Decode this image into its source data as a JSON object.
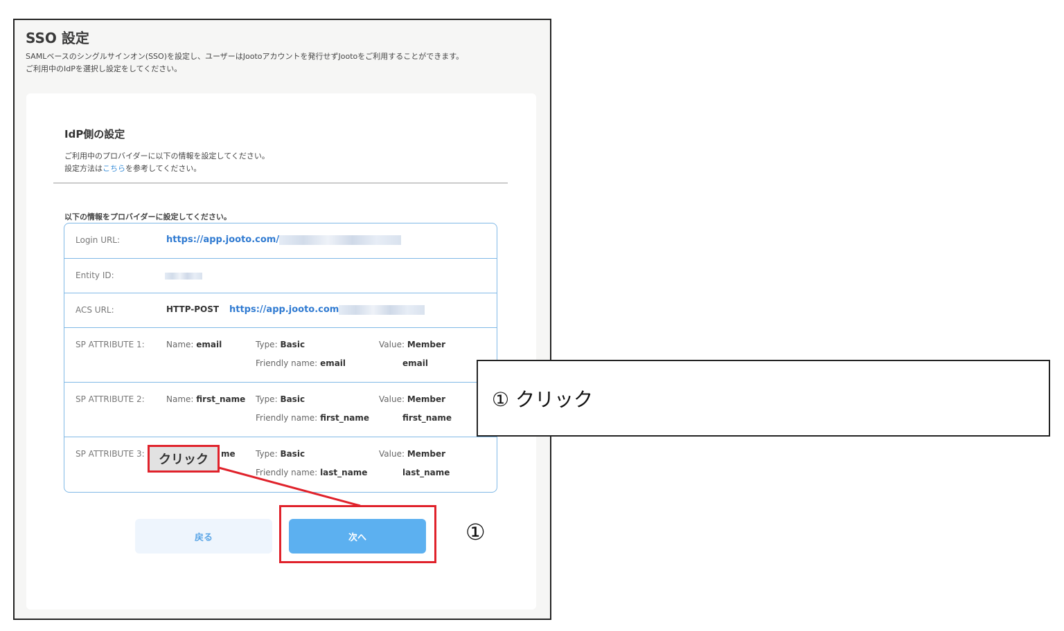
{
  "page": {
    "title": "SSO 設定",
    "desc_line1": "SAMLベースのシングルサインオン(SSO)を設定し、ユーザーはJootoアカウントを発行せずJootoをご利用することができます。",
    "desc_line2": "ご利用中のIdPを選択し設定をしてください。"
  },
  "card": {
    "title": "IdP側の設定",
    "desc_line1": "ご利用中のプロバイダーに以下の情報を設定してください。",
    "desc_line2_pre": "設定方法は",
    "desc_link": "こちら",
    "desc_line2_post": "を参考してください。",
    "list_label": "以下の情報をプロバイダーに設定してください。"
  },
  "table": {
    "login": {
      "label": "Login URL:",
      "value": "https://app.jooto.com/"
    },
    "entity": {
      "label": "Entity ID:"
    },
    "acs": {
      "label": "ACS URL:",
      "method": "HTTP-POST",
      "value": "https://app.jooto.com"
    },
    "attr1": {
      "label": "SP ATTRIBUTE 1:",
      "name_label": "Name:",
      "name": "email",
      "type_label": "Type:",
      "type": "Basic",
      "friendly_label": "Friendly name:",
      "friendly": "email",
      "value_label": "Value:",
      "value1": "Member",
      "value2": "email"
    },
    "attr2": {
      "label": "SP ATTRIBUTE 2:",
      "name_label": "Name:",
      "name": "first_name",
      "type_label": "Type:",
      "type": "Basic",
      "friendly_label": "Friendly name:",
      "friendly": "first_name",
      "value_label": "Value:",
      "value1": "Member",
      "value2": "first_name"
    },
    "attr3": {
      "label": "SP ATTRIBUTE 3:",
      "name_tail": "me",
      "type_label": "Type:",
      "type": "Basic",
      "friendly_label": "Friendly name:",
      "friendly": "last_name",
      "value_label": "Value:",
      "value1": "Member",
      "value2": "last_name"
    }
  },
  "buttons": {
    "back": "戻る",
    "next": "次へ"
  },
  "annotation": {
    "small_callout": "クリック",
    "circled_number": "①",
    "note": "① クリック",
    "color": "#e0222b"
  }
}
